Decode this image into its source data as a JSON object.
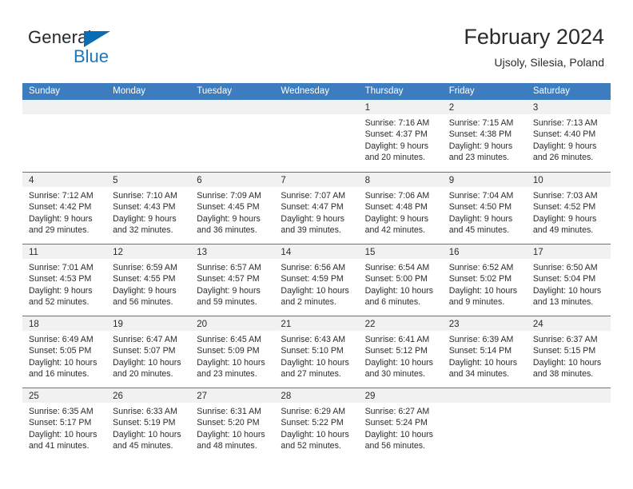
{
  "brand": {
    "name_top": "General",
    "name_bottom": "Blue",
    "triangle_icon": "blue-triangle-logo-mark",
    "color_top": "#23282d",
    "color_bottom": "#1878be",
    "triangle_color": "#0a6cb4"
  },
  "header": {
    "title": "February 2024",
    "subtitle": "Ujsoly, Silesia, Poland"
  },
  "theme": {
    "header_blue": "#3d7dbf",
    "day_band_gray": "#f1f1f1",
    "text": "#2b2b2b"
  },
  "weekdays": [
    "Sunday",
    "Monday",
    "Tuesday",
    "Wednesday",
    "Thursday",
    "Friday",
    "Saturday"
  ],
  "weeks": [
    [
      {
        "day": "",
        "empty": true,
        "lines": []
      },
      {
        "day": "",
        "empty": true,
        "lines": []
      },
      {
        "day": "",
        "empty": true,
        "lines": []
      },
      {
        "day": "",
        "empty": true,
        "lines": []
      },
      {
        "day": "1",
        "empty": false,
        "lines": [
          "Sunrise: 7:16 AM",
          "Sunset: 4:37 PM",
          "Daylight: 9 hours",
          "and 20 minutes."
        ]
      },
      {
        "day": "2",
        "empty": false,
        "lines": [
          "Sunrise: 7:15 AM",
          "Sunset: 4:38 PM",
          "Daylight: 9 hours",
          "and 23 minutes."
        ]
      },
      {
        "day": "3",
        "empty": false,
        "lines": [
          "Sunrise: 7:13 AM",
          "Sunset: 4:40 PM",
          "Daylight: 9 hours",
          "and 26 minutes."
        ]
      }
    ],
    [
      {
        "day": "4",
        "empty": false,
        "lines": [
          "Sunrise: 7:12 AM",
          "Sunset: 4:42 PM",
          "Daylight: 9 hours",
          "and 29 minutes."
        ]
      },
      {
        "day": "5",
        "empty": false,
        "lines": [
          "Sunrise: 7:10 AM",
          "Sunset: 4:43 PM",
          "Daylight: 9 hours",
          "and 32 minutes."
        ]
      },
      {
        "day": "6",
        "empty": false,
        "lines": [
          "Sunrise: 7:09 AM",
          "Sunset: 4:45 PM",
          "Daylight: 9 hours",
          "and 36 minutes."
        ]
      },
      {
        "day": "7",
        "empty": false,
        "lines": [
          "Sunrise: 7:07 AM",
          "Sunset: 4:47 PM",
          "Daylight: 9 hours",
          "and 39 minutes."
        ]
      },
      {
        "day": "8",
        "empty": false,
        "lines": [
          "Sunrise: 7:06 AM",
          "Sunset: 4:48 PM",
          "Daylight: 9 hours",
          "and 42 minutes."
        ]
      },
      {
        "day": "9",
        "empty": false,
        "lines": [
          "Sunrise: 7:04 AM",
          "Sunset: 4:50 PM",
          "Daylight: 9 hours",
          "and 45 minutes."
        ]
      },
      {
        "day": "10",
        "empty": false,
        "lines": [
          "Sunrise: 7:03 AM",
          "Sunset: 4:52 PM",
          "Daylight: 9 hours",
          "and 49 minutes."
        ]
      }
    ],
    [
      {
        "day": "11",
        "empty": false,
        "lines": [
          "Sunrise: 7:01 AM",
          "Sunset: 4:53 PM",
          "Daylight: 9 hours",
          "and 52 minutes."
        ]
      },
      {
        "day": "12",
        "empty": false,
        "lines": [
          "Sunrise: 6:59 AM",
          "Sunset: 4:55 PM",
          "Daylight: 9 hours",
          "and 56 minutes."
        ]
      },
      {
        "day": "13",
        "empty": false,
        "lines": [
          "Sunrise: 6:57 AM",
          "Sunset: 4:57 PM",
          "Daylight: 9 hours",
          "and 59 minutes."
        ]
      },
      {
        "day": "14",
        "empty": false,
        "lines": [
          "Sunrise: 6:56 AM",
          "Sunset: 4:59 PM",
          "Daylight: 10 hours",
          "and 2 minutes."
        ]
      },
      {
        "day": "15",
        "empty": false,
        "lines": [
          "Sunrise: 6:54 AM",
          "Sunset: 5:00 PM",
          "Daylight: 10 hours",
          "and 6 minutes."
        ]
      },
      {
        "day": "16",
        "empty": false,
        "lines": [
          "Sunrise: 6:52 AM",
          "Sunset: 5:02 PM",
          "Daylight: 10 hours",
          "and 9 minutes."
        ]
      },
      {
        "day": "17",
        "empty": false,
        "lines": [
          "Sunrise: 6:50 AM",
          "Sunset: 5:04 PM",
          "Daylight: 10 hours",
          "and 13 minutes."
        ]
      }
    ],
    [
      {
        "day": "18",
        "empty": false,
        "lines": [
          "Sunrise: 6:49 AM",
          "Sunset: 5:05 PM",
          "Daylight: 10 hours",
          "and 16 minutes."
        ]
      },
      {
        "day": "19",
        "empty": false,
        "lines": [
          "Sunrise: 6:47 AM",
          "Sunset: 5:07 PM",
          "Daylight: 10 hours",
          "and 20 minutes."
        ]
      },
      {
        "day": "20",
        "empty": false,
        "lines": [
          "Sunrise: 6:45 AM",
          "Sunset: 5:09 PM",
          "Daylight: 10 hours",
          "and 23 minutes."
        ]
      },
      {
        "day": "21",
        "empty": false,
        "lines": [
          "Sunrise: 6:43 AM",
          "Sunset: 5:10 PM",
          "Daylight: 10 hours",
          "and 27 minutes."
        ]
      },
      {
        "day": "22",
        "empty": false,
        "lines": [
          "Sunrise: 6:41 AM",
          "Sunset: 5:12 PM",
          "Daylight: 10 hours",
          "and 30 minutes."
        ]
      },
      {
        "day": "23",
        "empty": false,
        "lines": [
          "Sunrise: 6:39 AM",
          "Sunset: 5:14 PM",
          "Daylight: 10 hours",
          "and 34 minutes."
        ]
      },
      {
        "day": "24",
        "empty": false,
        "lines": [
          "Sunrise: 6:37 AM",
          "Sunset: 5:15 PM",
          "Daylight: 10 hours",
          "and 38 minutes."
        ]
      }
    ],
    [
      {
        "day": "25",
        "empty": false,
        "lines": [
          "Sunrise: 6:35 AM",
          "Sunset: 5:17 PM",
          "Daylight: 10 hours",
          "and 41 minutes."
        ]
      },
      {
        "day": "26",
        "empty": false,
        "lines": [
          "Sunrise: 6:33 AM",
          "Sunset: 5:19 PM",
          "Daylight: 10 hours",
          "and 45 minutes."
        ]
      },
      {
        "day": "27",
        "empty": false,
        "lines": [
          "Sunrise: 6:31 AM",
          "Sunset: 5:20 PM",
          "Daylight: 10 hours",
          "and 48 minutes."
        ]
      },
      {
        "day": "28",
        "empty": false,
        "lines": [
          "Sunrise: 6:29 AM",
          "Sunset: 5:22 PM",
          "Daylight: 10 hours",
          "and 52 minutes."
        ]
      },
      {
        "day": "29",
        "empty": false,
        "lines": [
          "Sunrise: 6:27 AM",
          "Sunset: 5:24 PM",
          "Daylight: 10 hours",
          "and 56 minutes."
        ]
      },
      {
        "day": "",
        "empty": true,
        "lines": []
      },
      {
        "day": "",
        "empty": true,
        "lines": []
      }
    ]
  ]
}
